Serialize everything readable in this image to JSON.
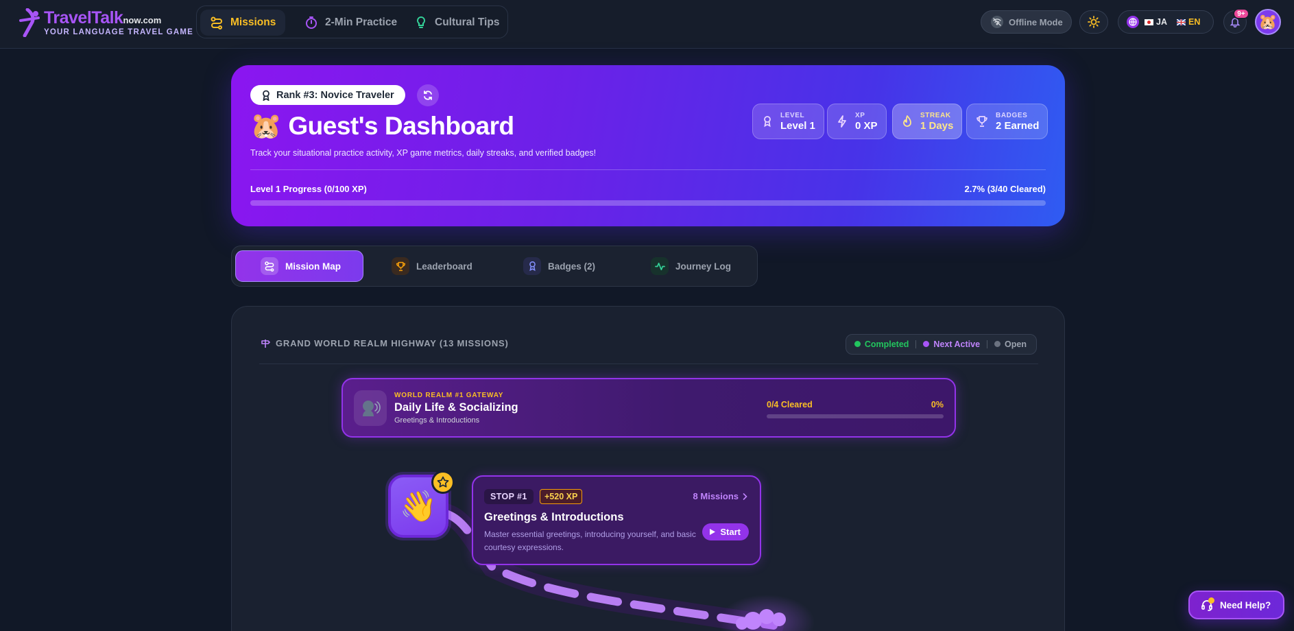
{
  "brand": {
    "name": "TravelTalk",
    "domain": "now.com",
    "tagline": "YOUR LANGUAGE TRAVEL GAME"
  },
  "nav": {
    "items": [
      {
        "label": "Missions",
        "icon": "route-icon",
        "active": true
      },
      {
        "label": "2-Min Practice",
        "icon": "stopwatch-icon",
        "active": false
      },
      {
        "label": "Cultural Tips",
        "icon": "lightbulb-icon",
        "active": false
      }
    ]
  },
  "header": {
    "offline_label": "Offline Mode",
    "lang_from": "JA",
    "lang_to": "EN",
    "notification_count": "9+"
  },
  "hero": {
    "rank": "Rank #3: Novice Traveler",
    "avatar_emoji": "🐹",
    "title": "Guest's Dashboard",
    "description": "Track your situational practice activity, XP game metrics, daily streaks, and verified badges!",
    "stats": [
      {
        "label": "LEVEL",
        "value": "Level 1",
        "icon": "ribbon-icon"
      },
      {
        "label": "XP",
        "value": "0 XP",
        "icon": "lightning-icon"
      },
      {
        "label": "STREAK",
        "value": "1 Days",
        "icon": "flame-icon"
      },
      {
        "label": "BADGES",
        "value": "2 Earned",
        "icon": "trophy-icon"
      }
    ],
    "progress_label": "Level 1 Progress (0/100 XP)",
    "progress_right": "2.7% (3/40 Cleared)",
    "progress_fraction": 0.0
  },
  "tabs": [
    {
      "label": "Mission Map",
      "icon": "route-icon",
      "active": true
    },
    {
      "label": "Leaderboard",
      "icon": "trophy-icon",
      "active": false
    },
    {
      "label": "Badges (2)",
      "icon": "ribbon-icon",
      "active": false
    },
    {
      "label": "Journey Log",
      "icon": "activity-icon",
      "active": false
    }
  ],
  "map": {
    "heading": "GRAND WORLD REALM HIGHWAY (13 MISSIONS)",
    "legend": [
      {
        "label": "Completed",
        "color": "#22c55e"
      },
      {
        "label": "Next Active",
        "color": "#a855f7"
      },
      {
        "label": "Open",
        "color": "#6b7280"
      }
    ],
    "gateway": {
      "kicker": "WORLD REALM #1 GATEWAY",
      "title": "Daily Life & Socializing",
      "subtitle": "Greetings & Introductions",
      "cleared": "0/4 Cleared",
      "percent": "0%",
      "icon": "speaking-head-icon"
    },
    "stop": {
      "emoji": "👋",
      "chip": "STOP #1",
      "xp": "+520 XP",
      "missions": "8 Missions",
      "title": "Greetings & Introductions",
      "description": "Master essential greetings, introducing yourself, and basic courtesy expressions.",
      "start_label": "Start"
    }
  },
  "help": {
    "label": "Need Help?"
  },
  "colors": {
    "accent": "#9333ea",
    "gold": "#fbbf24",
    "background": "#111827"
  }
}
